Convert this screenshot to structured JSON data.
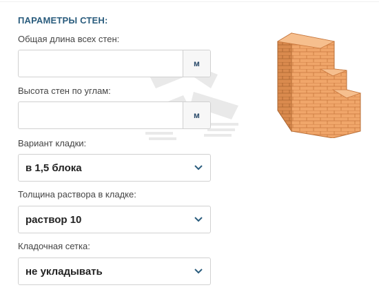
{
  "section": {
    "title": "ПАРАМЕТРЫ СТЕН:"
  },
  "fields": {
    "wall_length": {
      "label": "Общая длина всех стен:",
      "value": "",
      "placeholder": "",
      "unit": "м"
    },
    "wall_height": {
      "label": "Высота стен по углам:",
      "value": "",
      "placeholder": "",
      "unit": "м"
    },
    "masonry_variant": {
      "label": "Вариант кладки:",
      "selected": "в 1,5 блока"
    },
    "mortar_thickness": {
      "label": "Толщина раствора в кладке:",
      "selected": "раствор 10"
    },
    "masonry_mesh": {
      "label": "Кладочная сетка:",
      "selected": "не укладывать"
    }
  },
  "icons": {
    "chevron": "chevron-down-icon",
    "illustration": "brick-wall-icon"
  },
  "colors": {
    "title": "#2a5c7d",
    "unit_text": "#2a4a6a",
    "chevron": "#2a5c7d",
    "brick": "#f0a66a",
    "brick_dark": "#c9783e"
  }
}
